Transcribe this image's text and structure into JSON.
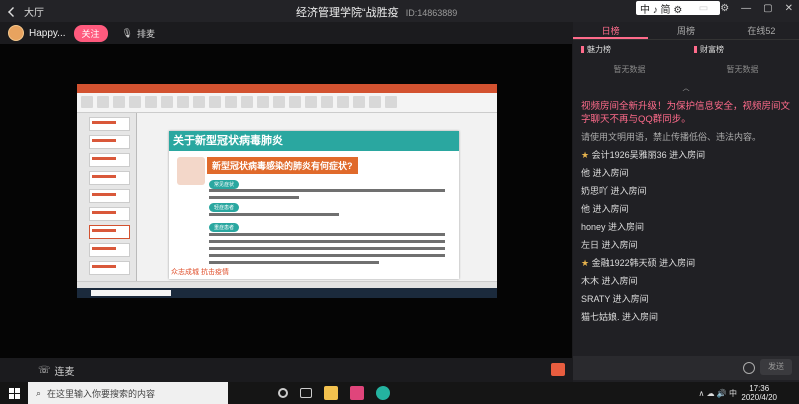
{
  "titlebar": {
    "back_label": "大厅",
    "room_title": "经济管理学院“战胜疫",
    "room_id": "ID:14863889",
    "logo_text": "中 ♪ 简 ⚙",
    "controls": [
      "▭",
      "⚙",
      "—",
      "▢",
      "✕"
    ]
  },
  "host": {
    "name": "Happy...",
    "follow_label": "关注",
    "mic_label": "排麦"
  },
  "slide": {
    "title": "关于新型冠状病毒肺炎",
    "question": "新型冠状病毒感染的肺炎有何症状?",
    "tags": [
      "常见症状",
      "轻症患者",
      "重症患者"
    ],
    "footer": "众志成城 抗击疫情"
  },
  "bottom_left": {
    "lianmai_label": "连麦"
  },
  "right_panel": {
    "tabs": [
      "日榜",
      "周榜",
      "在线52"
    ],
    "ranks": [
      {
        "label": "魅力榜",
        "empty": "暂无数据"
      },
      {
        "label": "财富榜",
        "empty": "暂无数据"
      }
    ],
    "messages": [
      {
        "type": "notice",
        "text": "视频房间全新升级！为保护信息安全，视频房间文字聊天不再与QQ群同步。"
      },
      {
        "type": "rule",
        "text": "请使用文明用语，禁止传播低俗、违法内容。"
      },
      {
        "type": "enter",
        "star": true,
        "text": "会计1926吴雅丽36 进入房间"
      },
      {
        "type": "enter",
        "star": false,
        "text": "他 进入房间"
      },
      {
        "type": "enter",
        "star": false,
        "text": "奶思吖 进入房间"
      },
      {
        "type": "enter",
        "star": false,
        "text": "他 进入房间"
      },
      {
        "type": "enter",
        "star": false,
        "text": "honey 进入房间"
      },
      {
        "type": "enter",
        "star": false,
        "text": "左日 进入房间"
      },
      {
        "type": "enter",
        "star": true,
        "text": "金融1922韩天硕 进入房间"
      },
      {
        "type": "enter",
        "star": false,
        "text": "木木 进入房间"
      },
      {
        "type": "enter",
        "star": false,
        "text": "SRATY 进入房间"
      },
      {
        "type": "enter",
        "star": false,
        "text": "猫七姑娘. 进入房间"
      }
    ],
    "send_label": "发送"
  },
  "taskbar": {
    "search_placeholder": "在这里输入你要搜索的内容",
    "tray_text": "∧ ☁ 🔊 中",
    "time": "17:36",
    "date": "2020/4/20"
  },
  "colors": {
    "accent": "#ff6b8b",
    "slide_teal": "#2aa7a0",
    "slide_orange": "#e06a2b"
  }
}
